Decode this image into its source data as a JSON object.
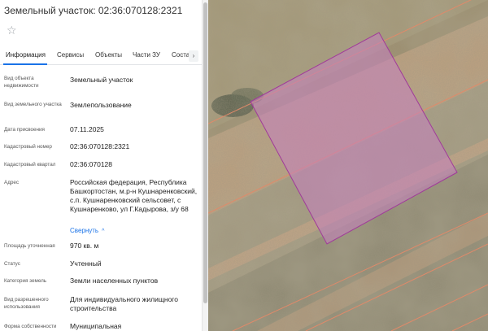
{
  "panel": {
    "title": "Земельный участок: 02:36:070128:2321",
    "tabs": [
      {
        "label": "Информация",
        "active": true
      },
      {
        "label": "Сервисы"
      },
      {
        "label": "Объекты"
      },
      {
        "label": "Части ЗУ"
      },
      {
        "label": "Соста"
      }
    ],
    "next_tab_glyph": "›",
    "fields": [
      {
        "label": "Вид объекта недвижимости",
        "value": "Земельный участок"
      },
      {
        "label": "Вид земельного участка",
        "value": "Землепользование"
      },
      {
        "label": "Дата присвоения",
        "value": "07.11.2025"
      },
      {
        "label": "Кадастровый номер",
        "value": "02:36:070128:2321"
      },
      {
        "label": "Кадастровый квартал",
        "value": "02:36:070128"
      },
      {
        "label": "Адрес",
        "value": "Российская федерация, Республика Башкортостан, м.р-н Кушнаренковский, с.п. Кушнаренковский сельсовет, с Кушнаренково, ул Г.Кадырова, з/у 68"
      },
      {
        "label": "Площадь уточненная",
        "value": "970 кв. м"
      },
      {
        "label": "Статус",
        "value": "Учтенный"
      },
      {
        "label": "Категория земель",
        "value": "Земли населенных пунктов"
      },
      {
        "label": "Вид разрешенного использования",
        "value": "Для индивидуального жилищного строительства"
      },
      {
        "label": "Форма собственности",
        "value": "Муниципальная"
      }
    ],
    "collapse_label": "Свернуть"
  },
  "map": {
    "parcel_fill": "#c77fbf",
    "parcel_stroke": "#a03a9a",
    "boundary_color": "#e08a6a"
  },
  "colors": {
    "accent": "#1a73e8"
  }
}
